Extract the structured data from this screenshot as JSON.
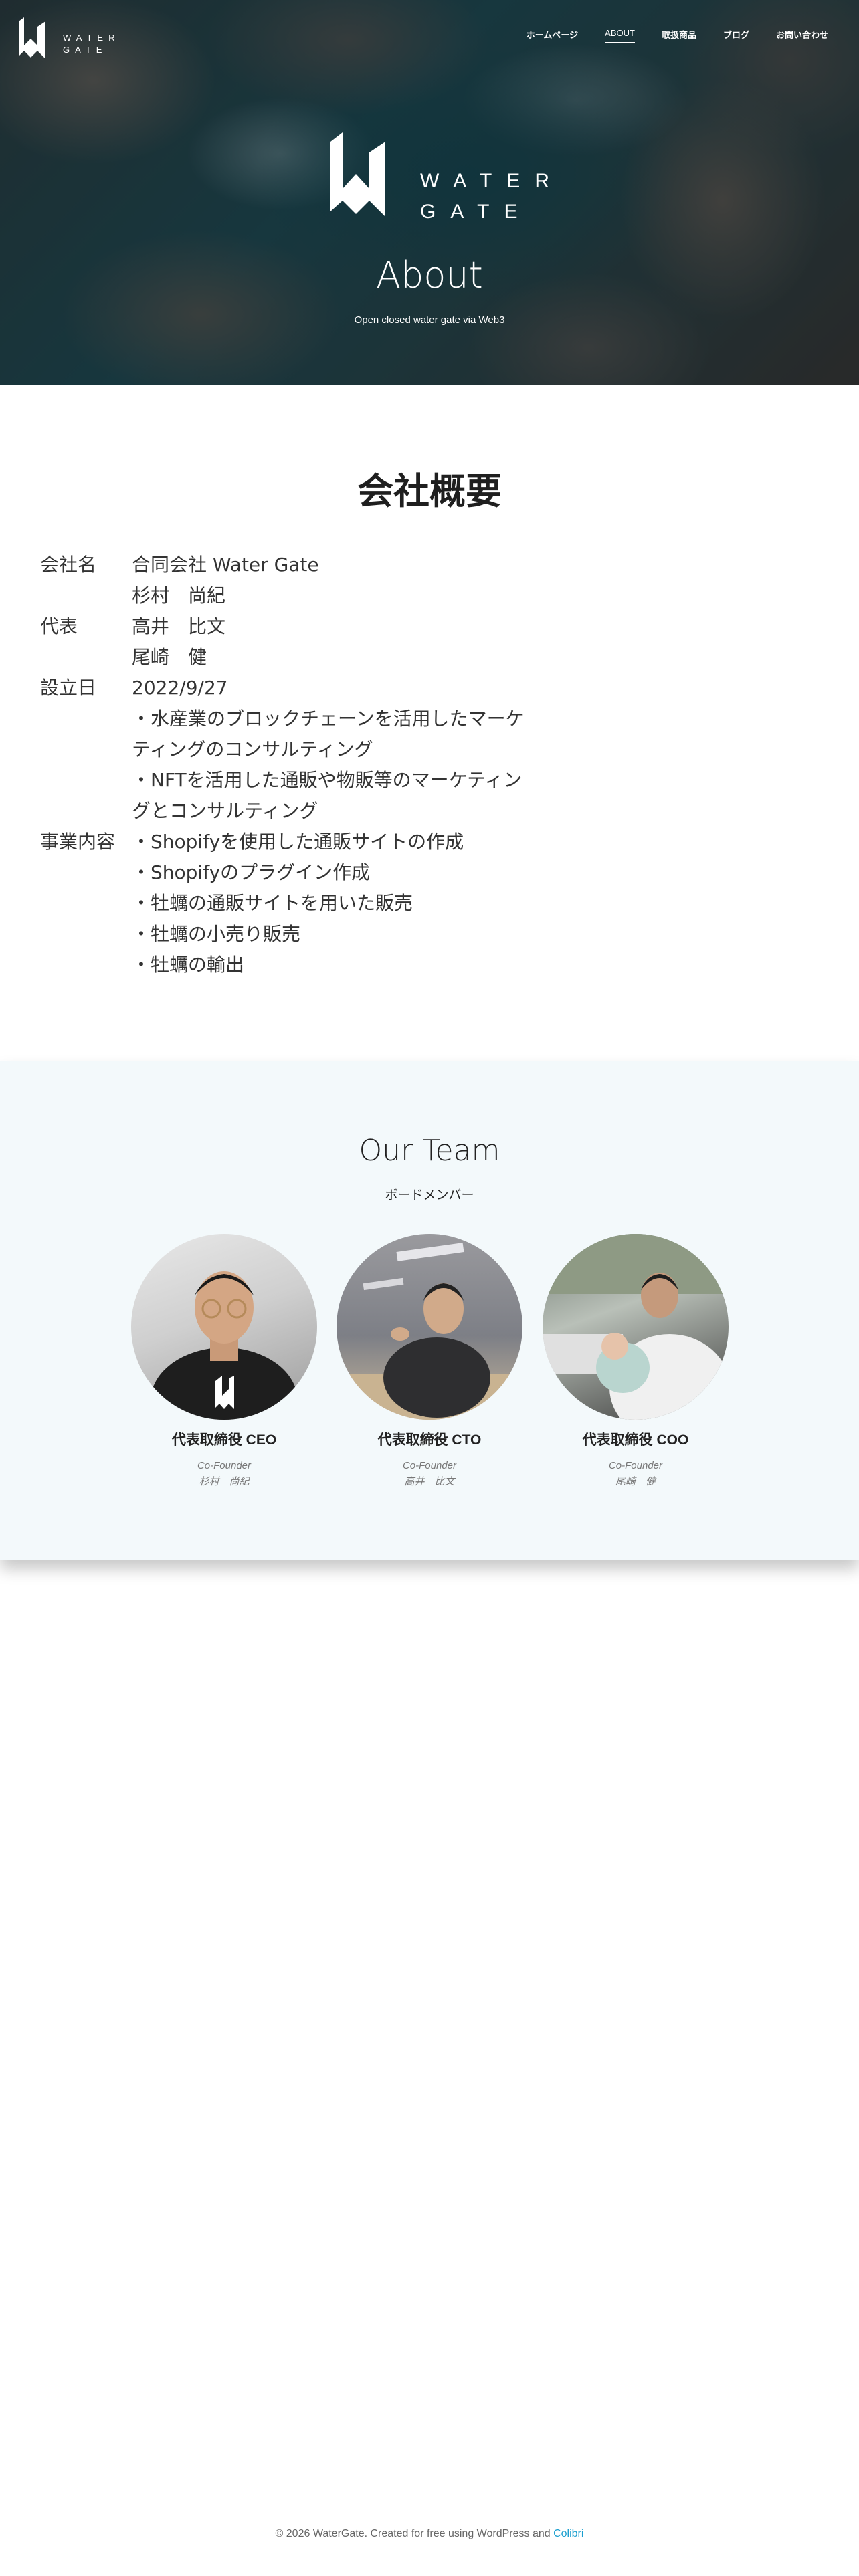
{
  "header": {
    "logo_text_line1": "WATER",
    "logo_text_line2": "GATE",
    "nav": [
      {
        "label": "ホームページ"
      },
      {
        "label": "ABOUT"
      },
      {
        "label": "取扱商品"
      },
      {
        "label": "ブログ"
      },
      {
        "label": "お問い合わせ"
      }
    ],
    "active_nav": "ABOUT"
  },
  "hero": {
    "logo_text_line1": "WATER",
    "logo_text_line2": "GATE",
    "title": "About",
    "subtitle": "Open closed water gate via Web3"
  },
  "overview": {
    "title": "会社概要",
    "company_label": "会社名",
    "company_value": "合同会社 Water Gate",
    "rep_label": "代表",
    "rep_names": [
      "杉村　尚紀",
      "高井　比文",
      "尾崎　健"
    ],
    "founded_label": "設立日",
    "founded_value": "2022/9/27",
    "business_label": "事業内容",
    "business_items": [
      "・水産業のブロックチェーンを活用したマーケ",
      "ティングのコンサルティング",
      "・NFTを活用した通販や物販等のマーケティン",
      "グとコンサルティング",
      "・Shopifyを使用した通販サイトの作成",
      "・Shopifyのプラグイン作成",
      "・牡蠣の通販サイトを用いた販売",
      "・牡蠣の小売り販売",
      "・牡蠣の輸出"
    ]
  },
  "team": {
    "title": "Our Team",
    "subtitle": "ボードメンバー",
    "members": [
      {
        "role": "代表取締役 CEO",
        "title": "Co-Founder",
        "name": "杉村　尚紀"
      },
      {
        "role": "代表取締役 CTO",
        "title": "Co-Founder",
        "name": "高井　比文"
      },
      {
        "role": "代表取締役 COO",
        "title": "Co-Founder",
        "name": "尾崎　健"
      }
    ]
  },
  "footer": {
    "text": "© 2026 WaterGate. Created for free using WordPress and ",
    "link": "Colibri"
  },
  "colors": {
    "team_bg": "#f3f9fb",
    "link": "#1b9fcf",
    "text": "#2b2b2b"
  }
}
